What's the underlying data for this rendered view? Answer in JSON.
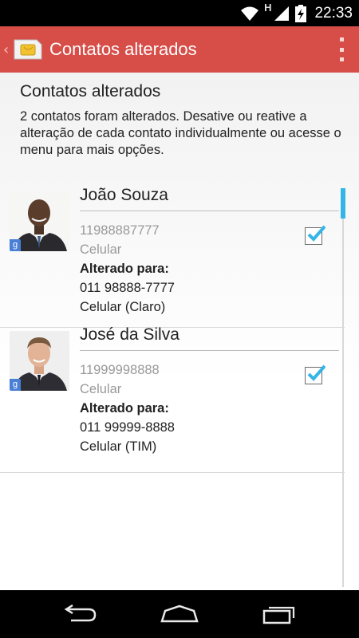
{
  "status_bar": {
    "time": "22:33",
    "network_label": "H",
    "icons": [
      "wifi-icon",
      "signal-icon",
      "battery-charging-icon"
    ]
  },
  "action_bar": {
    "title": "Contatos alterados",
    "icons": [
      "up-chevron-icon",
      "sim-card-app-icon",
      "overflow-menu-icon"
    ],
    "background_color": "#d74d48"
  },
  "content": {
    "title": "Contatos alterados",
    "description": "2 contatos foram alterados. Desative ou reative a alteração de cada contato individualmente ou acesse o menu para mais opções."
  },
  "contacts": [
    {
      "name": "João Souza",
      "old_number": "11988887777",
      "old_type": "Celular",
      "changed_label": "Alterado para:",
      "new_number": "011 98888-7777",
      "new_type": "Celular (Claro)",
      "checked": true,
      "badge": "g"
    },
    {
      "name": "José da Silva",
      "old_number": "11999998888",
      "old_type": "Celular",
      "changed_label": "Alterado para:",
      "new_number": "011 99999-8888",
      "new_type": "Celular (TIM)",
      "checked": true,
      "badge": "g"
    }
  ],
  "nav_bar": {
    "icons": [
      "back-icon",
      "home-icon",
      "recent-apps-icon"
    ]
  },
  "colors": {
    "accent": "#33b5e5",
    "action_bar": "#d74d48"
  }
}
